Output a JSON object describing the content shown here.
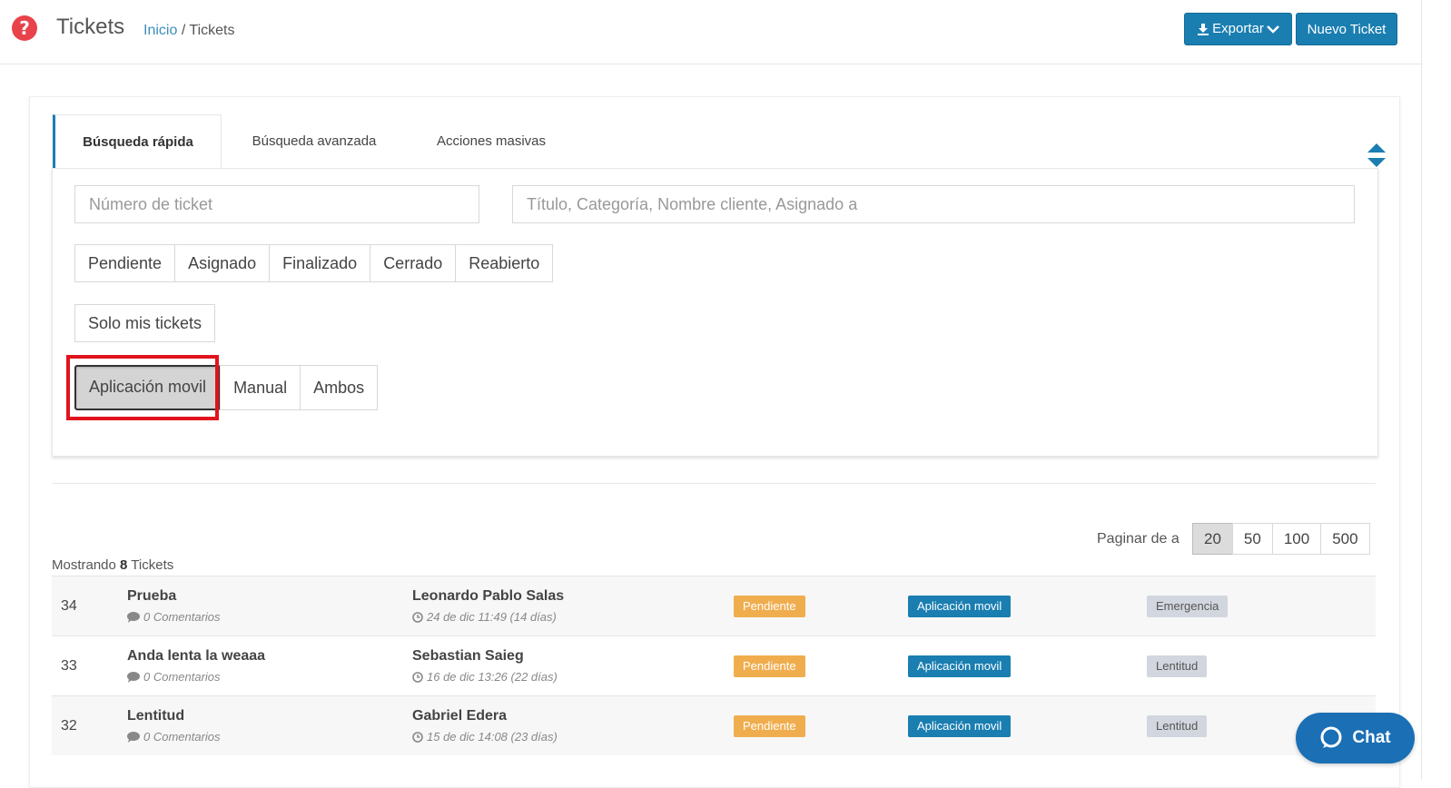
{
  "header": {
    "title": "Tickets",
    "breadcrumb_home": "Inicio",
    "breadcrumb_sep": "/",
    "breadcrumb_current": "Tickets",
    "export_label": "Exportar",
    "new_ticket_label": "Nuevo Ticket"
  },
  "tabs": {
    "quick": "Búsqueda rápida",
    "advanced": "Búsqueda avanzada",
    "bulk": "Acciones masivas"
  },
  "search": {
    "ticket_placeholder": "Número de ticket",
    "query_placeholder": "Título, Categoría, Nombre cliente, Asignado a"
  },
  "status_filters": [
    "Pendiente",
    "Asignado",
    "Finalizado",
    "Cerrado",
    "Reabierto"
  ],
  "mine_filter": "Solo mis tickets",
  "origin_filters": {
    "app": "Aplicación movil",
    "manual": "Manual",
    "both": "Ambos"
  },
  "pagination": {
    "label": "Paginar de a",
    "options": [
      "20",
      "50",
      "100",
      "500"
    ],
    "selected": "20"
  },
  "summary": {
    "prefix": "Mostrando",
    "count": "8",
    "suffix": "Tickets"
  },
  "tickets": [
    {
      "id": "34",
      "title": "Prueba",
      "comments": "0 Comentarios",
      "client": "Leonardo Pablo Salas",
      "date": "24 de dic 11:49 (14 días)",
      "status": "Pendiente",
      "origin": "Aplicación movil",
      "category": "Emergencia"
    },
    {
      "id": "33",
      "title": "Anda lenta la weaaa",
      "comments": "0 Comentarios",
      "client": "Sebastian Saieg",
      "date": "16 de dic 13:26 (22 días)",
      "status": "Pendiente",
      "origin": "Aplicación movil",
      "category": "Lentitud"
    },
    {
      "id": "32",
      "title": "Lentitud",
      "comments": "0 Comentarios",
      "client": "Gabriel Edera",
      "date": "15 de dic 14:08 (23 días)",
      "status": "Pendiente",
      "origin": "Aplicación movil",
      "category": "Lentitud"
    }
  ],
  "chat": {
    "label": "Chat"
  },
  "colors": {
    "primary": "#1a7eb1",
    "pending": "#f0ad4e",
    "highlight": "#e0141e",
    "help": "#e8424b"
  }
}
